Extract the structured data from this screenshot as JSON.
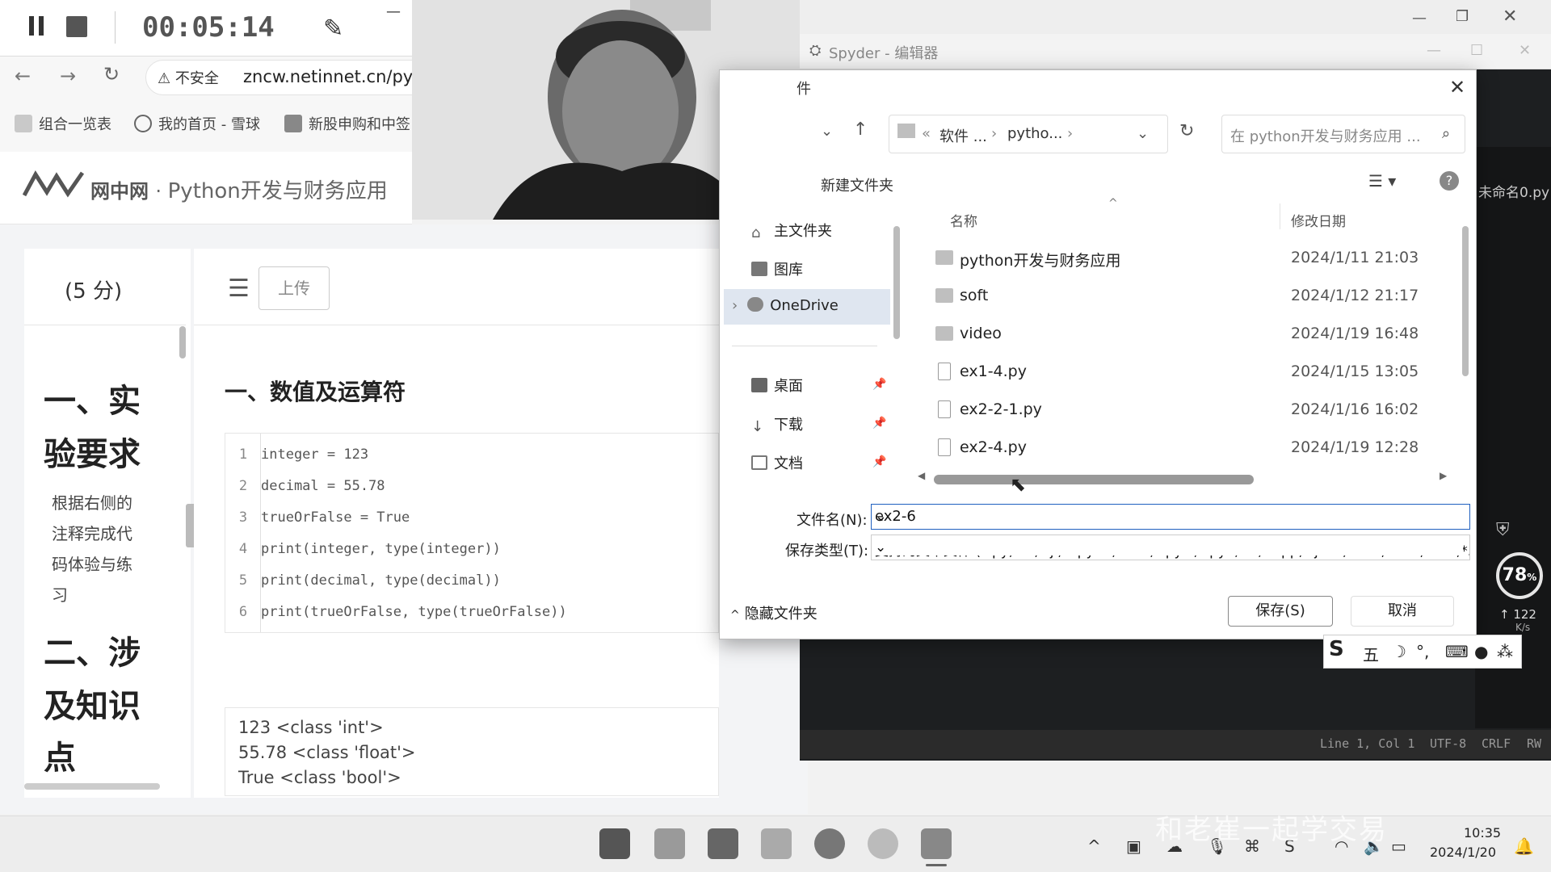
{
  "recorder": {
    "time": "00:05:14"
  },
  "browser": {
    "security_label": "不安全",
    "url": "zncw.netinnet.cn/pyt",
    "bookmarks": [
      "组合一览表",
      "我的首页 - 雪球",
      "新股申购和中签"
    ],
    "site_logo": "网中网",
    "site_title": "Python开发与财务应用"
  },
  "exercise": {
    "score": "(5 分)",
    "upload_label": "上传",
    "section1_title": "一、实验要求",
    "section1_heading_lines": [
      "一、实",
      "验要求"
    ],
    "instructions": "根据右侧的注释完成代码体验与练习",
    "section2_heading_lines": [
      "二、涉",
      "及知识",
      "点"
    ],
    "content_title": "一、数值及运算符",
    "code_lines": [
      {
        "n": "1",
        "text": "integer = 123"
      },
      {
        "n": "2",
        "text": "decimal = 55.78"
      },
      {
        "n": "3",
        "text": "trueOrFalse = True"
      },
      {
        "n": "4",
        "text": "print(integer, type(integer))"
      },
      {
        "n": "5",
        "text": "print(decimal, type(decimal))"
      },
      {
        "n": "6",
        "text": "print(trueOrFalse, type(trueOrFalse))"
      }
    ],
    "output_lines": [
      "123 <class 'int'>",
      "55.78 <class 'float'>",
      "True <class 'bool'>"
    ]
  },
  "spyder": {
    "title": "Spyder - 编辑器",
    "tab": "未命名0.py",
    "status": [
      "Line 1, Col 1",
      "UTF-8",
      "CRLF",
      "RW"
    ],
    "gauge_percent": "78",
    "net_speed": "122",
    "net_unit": "K/s"
  },
  "dialog": {
    "title_fragment": "件",
    "breadcrumb": [
      "软件 ...",
      "pytho..."
    ],
    "search_placeholder": "在 python开发与财务应用 ...",
    "new_folder": "新建文件夹",
    "nav_items": [
      "主文件夹",
      "图库",
      "OneDrive",
      "桌面",
      "下载",
      "文档"
    ],
    "col_name": "名称",
    "col_date": "修改日期",
    "files": [
      {
        "name": "python开发与财务应用",
        "date": "2024/1/11 21:03",
        "kind": "folder"
      },
      {
        "name": "soft",
        "date": "2024/1/12 21:17",
        "kind": "folder"
      },
      {
        "name": "video",
        "date": "2024/1/19 16:48",
        "kind": "folder"
      },
      {
        "name": "ex1-4.py",
        "date": "2024/1/15 13:05",
        "kind": "py"
      },
      {
        "name": "ex2-2-1.py",
        "date": "2024/1/16 16:02",
        "kind": "py"
      },
      {
        "name": "ex2-4.py",
        "date": "2024/1/19 12:28",
        "kind": "py"
      }
    ],
    "filename_label": "文件名(N):",
    "filename_value": "ex2-6",
    "filetype_label": "保存类型(T):",
    "filetype_value": "支持的文本文件 (*.py;*.R;*.jl;*.ipynb;*.md;*.pyw;*.pyx;*.c;*.cpp;*.json;*.dat;*.csv;*.tsv;*.t",
    "hide_folders": "隐藏文件夹",
    "save_button": "保存(S)",
    "cancel_button": "取消"
  },
  "ime": {
    "mode": "五"
  },
  "taskbar": {
    "time": "10:35",
    "date": "2024/1/20",
    "watermark": "和老崔一起学交易"
  }
}
